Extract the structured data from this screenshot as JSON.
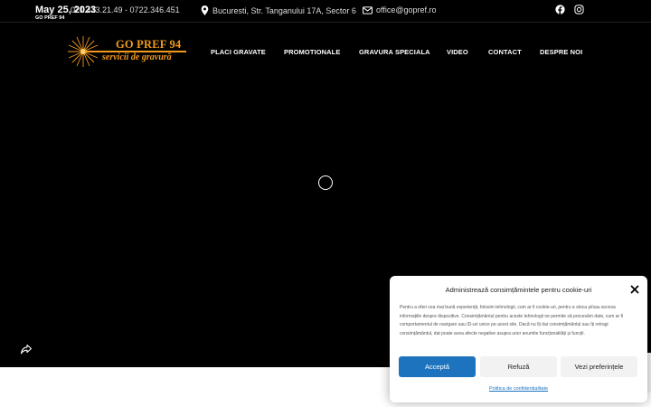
{
  "topbar": {
    "date": "May 25, 2023",
    "date_sub": "GO PREF 94",
    "phone": "021.413.21.49 - 0722.346.451",
    "address": "Bucuresti, Str. Tanganului 17A, Sector 6",
    "email": "office@gopref.ro",
    "social": [
      "facebook-icon",
      "instagram-icon"
    ]
  },
  "logo": {
    "title": "GO PREF 94",
    "subtitle": "servicii de gravură"
  },
  "nav": {
    "items": [
      "PLACI GRAVATE",
      "PROMOTIONALE",
      "GRAVURA SPECIALA",
      "VIDEO",
      "CONTACT",
      "DESPRE NOI"
    ]
  },
  "cookie": {
    "title": "Administrează consimțămintele pentru cookie-uri",
    "body": "Pentru a oferi cea mai bună experiență, folosim tehnologii, cum ar fi cookie-uri, pentru a stoca și/sau accesa informațiile despre dispozitive. Consimțământul pentru aceste tehnologii ne permite să procesăm date, cum ar fi comportamentul de navigare sau ID-uri unice pe acest site. Dacă nu îți dai consimțământul sau îți retragi consimțământul, dat poate avea afecte negative asupra unor anumite funcționalități și funcții.",
    "accept": "Acceptă",
    "deny": "Refuză",
    "preferences": "Vezi preferințele",
    "policy_link": "Politica de confidentialitate"
  },
  "colors": {
    "brand_orange": "#f39a1c",
    "accept_blue": "#1e73be",
    "hero_bg": "#000000"
  }
}
